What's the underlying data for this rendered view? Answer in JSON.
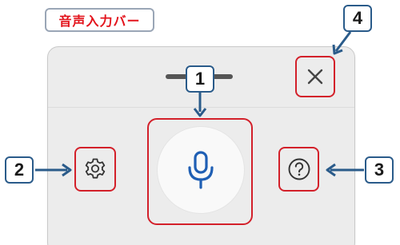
{
  "title_label": "音声入力バー",
  "callouts": {
    "mic": "1",
    "settings": "2",
    "help": "3",
    "close": "4"
  },
  "icons": {
    "mic": "microphone-icon",
    "settings": "gear-icon",
    "help": "question-mark-icon",
    "close": "close-icon"
  },
  "colors": {
    "highlight": "#d3202a",
    "title_text": "#e3141c",
    "callout_border": "#2a5b8a",
    "mic_icon": "#1f5fb4",
    "panel_bg": "#ececec"
  }
}
